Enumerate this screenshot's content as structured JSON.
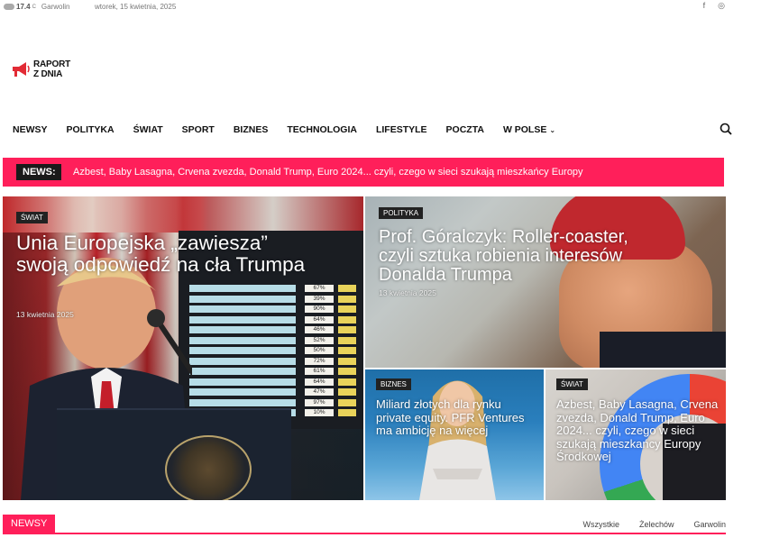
{
  "topbar": {
    "temperature": "17.4",
    "degree": "C",
    "city": "Garwolin",
    "date": "wtorek, 15 kwietnia, 2025",
    "social": [
      "f",
      "◎"
    ]
  },
  "logo": {
    "line1": "RAPORT",
    "line2": "Z DNIA"
  },
  "nav": {
    "items": [
      "NEWSY",
      "POLITYKA",
      "ŚWIAT",
      "SPORT",
      "BIZNES",
      "TECHNOLOGIA",
      "LIFESTYLE",
      "POCZTA",
      "W POLSE"
    ],
    "dropdown_icon": "chevron-down-icon",
    "search_icon": "search-icon"
  },
  "ticker": {
    "label": "NEWS:",
    "text": "Azbest, Baby Lasagna, Crvena zvezda, Donald Trump, Euro 2024... czyli, czego w sieci szukają mieszkańcy Europy"
  },
  "featured": [
    {
      "category": "ŚWIAT",
      "title": "Unia Europejska „zawiesza” swoją odpowiedź na cła Trumpa",
      "date": "13 kwietnia 2025"
    },
    {
      "category": "POLITYKA",
      "title": "Prof. Góralczyk: Roller-coaster, czyli sztuka robienia interesów Donalda Trumpa",
      "date": "13 kwietnia 2025"
    },
    {
      "category": "BIZNES",
      "title": "Miliard złotych dla rynku private equity. PFR Ventures ma ambicję na więcej"
    },
    {
      "category": "ŚWIAT",
      "title": "Azbest, Baby Lasagna, Crvena zvezda, Donald Trump, Euro 2024... czyli, czego w sieci szukają mieszkańcy Europy Środkowej"
    }
  ],
  "tariff_board": {
    "rows": [
      {
        "v": "67%"
      },
      {
        "v": "39%"
      },
      {
        "v": "90%"
      },
      {
        "v": "64%"
      },
      {
        "v": "46%"
      },
      {
        "v": "52%"
      },
      {
        "v": "50%"
      },
      {
        "v": "72%"
      },
      {
        "v": "61%"
      },
      {
        "v": "64%"
      },
      {
        "v": "47%"
      },
      {
        "v": "97%"
      },
      {
        "v": "10%"
      }
    ]
  },
  "section": {
    "label": "NEWSY",
    "tabs": [
      "Wszystkie",
      "Żelechów",
      "Garwolin"
    ]
  },
  "colors": {
    "accent": "#ff1f5a",
    "dark": "#1a1a1a"
  }
}
